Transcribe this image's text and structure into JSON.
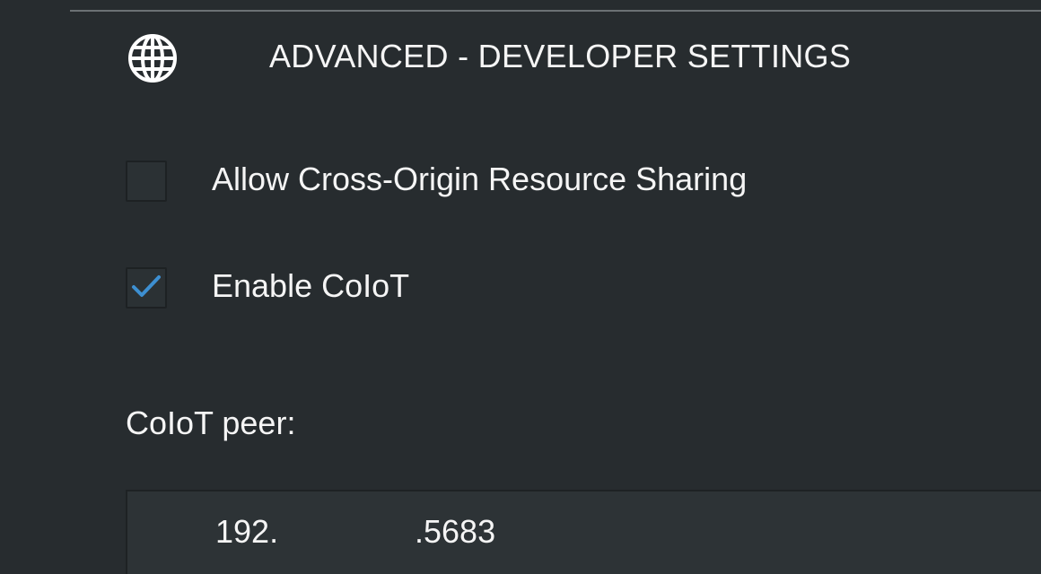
{
  "section": {
    "title": "ADVANCED - DEVELOPER SETTINGS",
    "icon": "globe-icon"
  },
  "options": [
    {
      "label": "Allow Cross-Origin Resource Sharing",
      "checked": false
    },
    {
      "label": "Enable CoIoT",
      "checked": true
    }
  ],
  "peer": {
    "label": "CoIoT peer:",
    "value_part1": "192.",
    "value_part2": ".5683"
  },
  "colors": {
    "background": "#272c2f",
    "checkmark": "#3d8fd1",
    "text": "#f5f5f5"
  }
}
